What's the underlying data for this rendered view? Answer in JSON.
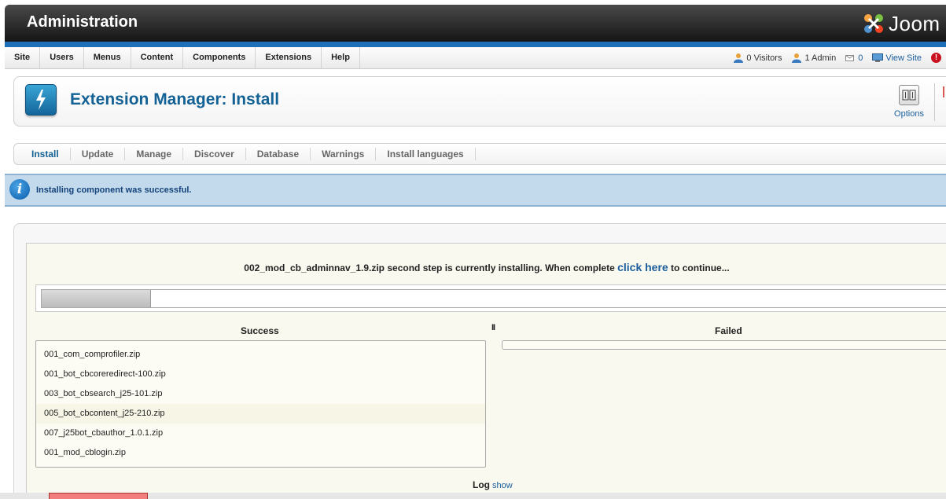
{
  "header": {
    "title": "Administration",
    "logo_text": "Joom"
  },
  "menu": [
    "Site",
    "Users",
    "Menus",
    "Content",
    "Components",
    "Extensions",
    "Help"
  ],
  "status": {
    "visitors": "0 Visitors",
    "admins": "1 Admin",
    "messages": "0",
    "view_site": "View Site",
    "alert": "!"
  },
  "toolbar": {
    "title": "Extension Manager: Install",
    "options_label": "Options"
  },
  "tabs": [
    "Install",
    "Update",
    "Manage",
    "Discover",
    "Database",
    "Warnings",
    "Install languages"
  ],
  "message": {
    "text": "Installing component was successful.",
    "icon": "i"
  },
  "installer": {
    "status_prefix": "002_mod_cb_adminnav_1.9.zip second step is currently installing. When complete",
    "link": "click here",
    "status_suffix": "to continue...",
    "progress": 0.12,
    "success_title": "Success",
    "failed_title": "Failed",
    "pause": "II",
    "success_items": [
      "001_com_comprofiler.zip",
      "001_bot_cbcoreredirect-100.zip",
      "003_bot_cbsearch_j25-101.zip",
      "005_bot_cbcontent_j25-210.zip",
      "007_j25bot_cbauthor_1.0.1.zip",
      "001_mod_cblogin.zip"
    ],
    "log_label": "Log",
    "log_show": "show"
  },
  "colors": {
    "brand": "#146295",
    "accent_band": "#1e6fb8",
    "message_bg": "#c3d9ec",
    "find_error": "#f37e7e"
  }
}
